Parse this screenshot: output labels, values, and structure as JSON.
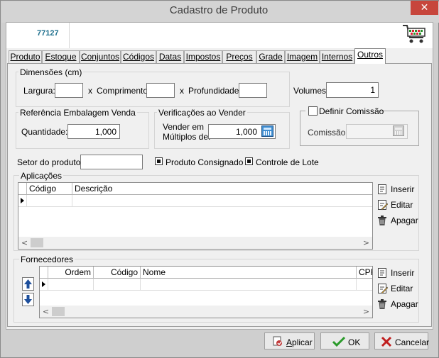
{
  "window": {
    "title": "Cadastro de Produto",
    "close_glyph": "✕"
  },
  "header": {
    "product_code": "77127",
    "cart_icon": "shopping-cart-icon"
  },
  "tabs": [
    "Produto",
    "Estoque",
    "Conjuntos",
    "Códigos",
    "Datas",
    "Impostos",
    "Preços",
    "Grade",
    "Imagem",
    "Internos",
    "Outros"
  ],
  "active_tab": "Outros",
  "dimensoes": {
    "title": "Dimensões (cm)",
    "largura_label": "Largura:",
    "x1": "x",
    "comprimento_label": "Comprimento:",
    "x2": "x",
    "profundidade_label": "Profundidade:",
    "largura_value": "",
    "comprimento_value": "",
    "profundidade_value": ""
  },
  "volumes": {
    "label": "Volumes:",
    "value": "1"
  },
  "embalagem": {
    "title": "Referência Embalagem Venda",
    "quantidade_label": "Quantidade:",
    "quantidade_value": "1,000"
  },
  "verificacoes": {
    "title": "Verificações ao Vender",
    "label_line1": "Vender em",
    "label_line2": "Múltiplos de:",
    "value": "1,000"
  },
  "comissao": {
    "checkbox_label": "Definir Comissão",
    "checked": false,
    "label": "Comissão:",
    "value": ""
  },
  "setor": {
    "label": "Setor do produto:",
    "value": ""
  },
  "produto_consignado": {
    "label": "Produto Consignado",
    "checked": true
  },
  "controle_lote": {
    "label": "Controle de Lote",
    "checked": true
  },
  "aplicacoes": {
    "title": "Aplicações",
    "columns": [
      "Código",
      "Descrição"
    ],
    "actions": {
      "insert": "Inserir",
      "edit": "Editar",
      "delete": "Apagar"
    }
  },
  "fornecedores": {
    "title": "Fornecedores",
    "columns": [
      "Ordem",
      "Código",
      "Nome",
      "CPF"
    ],
    "actions": {
      "insert": "Inserir",
      "edit": "Editar",
      "delete": "Apagar"
    }
  },
  "footer": {
    "apply": "Aplicar",
    "ok": "OK",
    "cancel": "Cancelar"
  },
  "colors": {
    "code_text": "#1c6e8c",
    "close_bg": "#c7463c",
    "ok_check": "#2a9a2a",
    "cancel_x": "#c02020"
  }
}
